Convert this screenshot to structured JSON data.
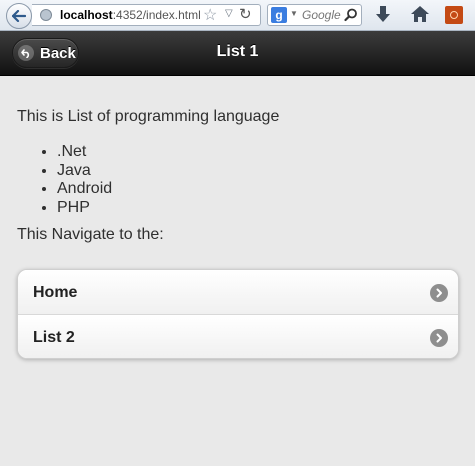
{
  "browser": {
    "url_host": "localhost",
    "url_rest": ":4352/index.html",
    "search_engine": "g",
    "search_placeholder": "Google",
    "icons": [
      "back-arrow-icon",
      "globe-icon",
      "star-icon",
      "reload-icon",
      "search-icon",
      "download-icon",
      "home-icon",
      "extension-icon"
    ]
  },
  "header": {
    "back_label": "Back",
    "title": "List 1"
  },
  "content": {
    "intro": "This is List of programming language",
    "languages": [
      ".Net",
      "Java",
      "Android",
      "PHP"
    ],
    "nav_text": "This Navigate to the:"
  },
  "listview": [
    {
      "label": "Home"
    },
    {
      "label": "List 2"
    }
  ],
  "colors": {
    "header_bg": "#1e1e1e",
    "page_bg": "#e9e9e9",
    "arrow_bg": "#8e8e8e"
  }
}
